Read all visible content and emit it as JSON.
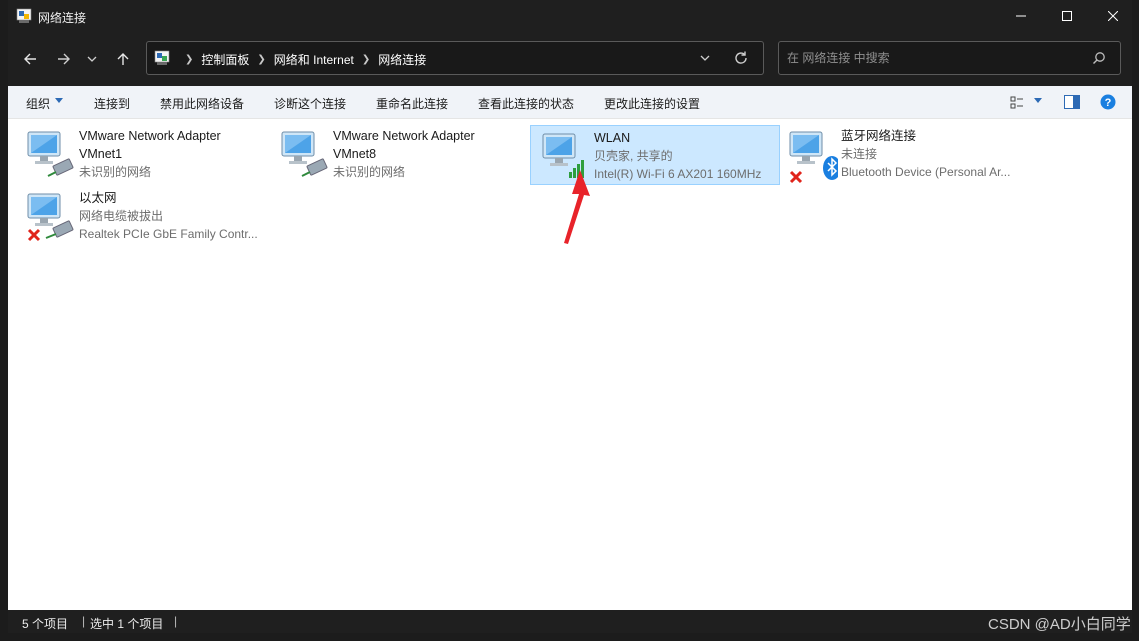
{
  "window": {
    "title": "网络连接"
  },
  "nav": {
    "back_icon": "arrow-left",
    "forward_icon": "arrow-right",
    "history_icon": "chevron-down",
    "up_icon": "arrow-up"
  },
  "address": {
    "crumbs": [
      "控制面板",
      "网络和 Internet",
      "网络连接"
    ]
  },
  "search": {
    "placeholder": "在 网络连接 中搜索"
  },
  "toolbar": {
    "organize": "组织",
    "connect": "连接到",
    "disable": "禁用此网络设备",
    "diagnose": "诊断这个连接",
    "rename": "重命名此连接",
    "status": "查看此连接的状态",
    "settings": "更改此连接的设置"
  },
  "connections": [
    {
      "name": "VMware Network Adapter VMnet1",
      "line1": "VMware Network Adapter",
      "line2": "VMnet1",
      "line3": "未识别的网络",
      "type": "wired",
      "status": "ok"
    },
    {
      "name": "VMware Network Adapter VMnet8",
      "line1": "VMware Network Adapter",
      "line2": "VMnet8",
      "line3": "未识别的网络",
      "type": "wired",
      "status": "ok"
    },
    {
      "name": "WLAN",
      "line1": "WLAN",
      "line2": "贝壳家, 共享的",
      "line3": "Intel(R) Wi-Fi 6 AX201 160MHz",
      "type": "wifi",
      "status": "connected",
      "selected": true
    },
    {
      "name": "蓝牙网络连接",
      "line1": "蓝牙网络连接",
      "line2": "未连接",
      "line3": "Bluetooth Device (Personal Ar...",
      "type": "bluetooth",
      "status": "disconnected"
    },
    {
      "name": "以太网",
      "line1": "以太网",
      "line2": "网络电缆被拔出",
      "line3": "Realtek PCIe GbE Family Contr...",
      "type": "ethernet",
      "status": "unplugged"
    }
  ],
  "statusbar": {
    "count": "5 个项目",
    "selected": "选中 1 个项目",
    "sep": "|"
  },
  "watermark": "CSDN @AD小白同学",
  "colors": {
    "selection_bg": "#cce8ff",
    "selection_border": "#99d1ff",
    "chrome_dark": "#1f1f1f",
    "annotation_red": "#e8232a",
    "wifi_green": "#2e9e3e",
    "bluetooth_blue": "#1a7fe0"
  }
}
